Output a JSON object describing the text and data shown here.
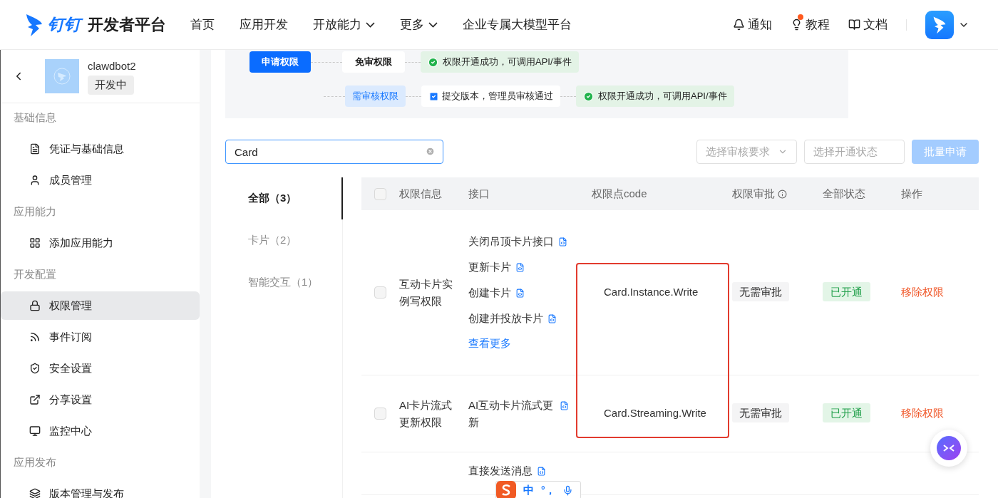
{
  "header": {
    "logo_text": "钉钉",
    "title": "开发者平台",
    "nav": [
      {
        "label": "首页",
        "dropdown": false
      },
      {
        "label": "应用开发",
        "dropdown": false
      },
      {
        "label": "开放能力",
        "dropdown": true
      },
      {
        "label": "更多",
        "dropdown": true
      },
      {
        "label": "企业专属大模型平台",
        "dropdown": false
      }
    ],
    "tools": [
      {
        "label": "通知",
        "badge": false
      },
      {
        "label": "教程",
        "badge": true
      },
      {
        "label": "文档",
        "badge": false
      }
    ]
  },
  "sidebar": {
    "app": {
      "name": "clawdbot2",
      "status": "开发中"
    },
    "sections": [
      {
        "title": "基础信息",
        "items": [
          {
            "label": "凭证与基础信息",
            "selected": false
          },
          {
            "label": "成员管理",
            "selected": false
          }
        ]
      },
      {
        "title": "应用能力",
        "items": [
          {
            "label": "添加应用能力",
            "selected": false
          }
        ]
      },
      {
        "title": "开发配置",
        "items": [
          {
            "label": "权限管理",
            "selected": true
          },
          {
            "label": "事件订阅",
            "selected": false
          },
          {
            "label": "安全设置",
            "selected": false
          },
          {
            "label": "分享设置",
            "selected": false
          },
          {
            "label": "监控中心",
            "selected": false
          }
        ]
      },
      {
        "title": "应用发布",
        "items": [
          {
            "label": "版本管理与发布",
            "selected": false
          }
        ]
      }
    ]
  },
  "flow": {
    "apply": "申请权限",
    "free": "免审权限",
    "free_result": "权限开通成功，可调用API/事件",
    "review": "需审核权限",
    "review_step": "提交版本，管理员审核通过",
    "review_result": "权限开通成功，可调用API/事件"
  },
  "search": {
    "value": "Card"
  },
  "filters": [
    {
      "kind": "select",
      "placeholder": "选择审核要求"
    },
    {
      "kind": "input",
      "placeholder": "选择开通状态"
    }
  ],
  "batch_button": {
    "label": "批量申请",
    "disabled": true
  },
  "categories": [
    {
      "label": "全部（3）",
      "selected": true
    },
    {
      "label": "卡片（2）",
      "selected": false
    },
    {
      "label": "智能交互（1）",
      "selected": false
    }
  ],
  "table": {
    "select_all": {
      "checked": false
    },
    "columns": [
      "权限信息",
      "接口",
      "权限点code",
      "权限审批",
      "全部状态",
      "操作"
    ],
    "rows": [
      {
        "checked": false,
        "name": "互动卡片实例写权限",
        "apis": [
          "关闭吊顶卡片接口",
          "更新卡片",
          "创建卡片",
          "创建并投放卡片"
        ],
        "more": "查看更多",
        "code": "Card.Instance.Write",
        "approval": "无需审批",
        "status": "已开通",
        "action": "移除权限"
      },
      {
        "checked": false,
        "name": "AI卡片流式更新权限",
        "apis": [
          "AI互动卡片流式更新"
        ],
        "code": "Card.Streaming.Write",
        "approval": "无需审批",
        "status": "已开通",
        "action": "移除权限"
      },
      {
        "apis": [
          "直接发送消息"
        ]
      }
    ]
  },
  "ime": {
    "mode": "中",
    "punct": "°，"
  }
}
